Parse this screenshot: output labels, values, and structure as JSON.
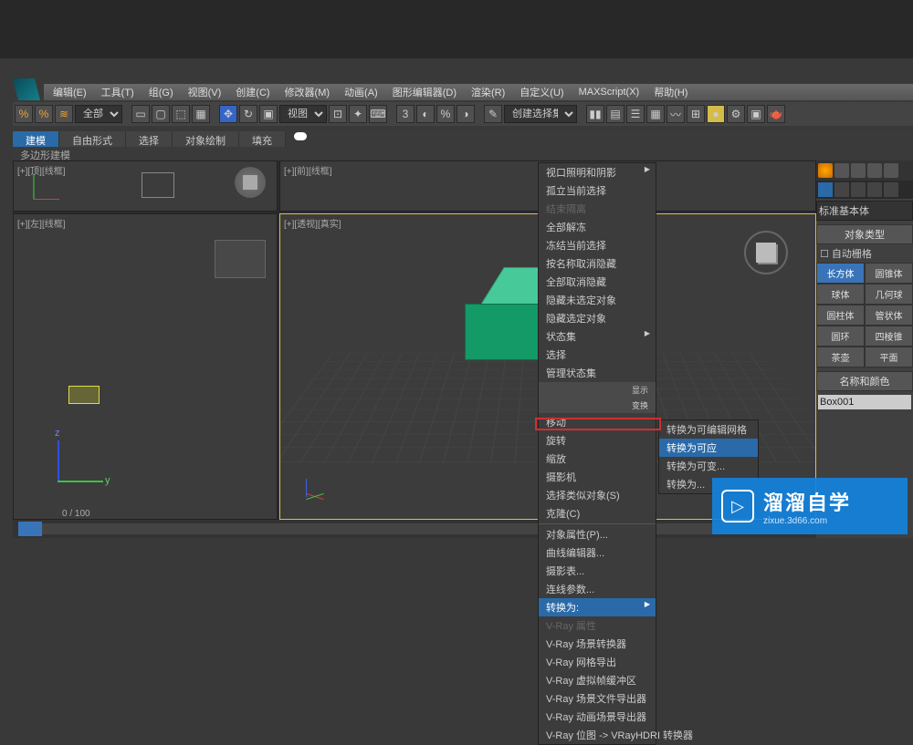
{
  "menubar": [
    "编辑(E)",
    "工具(T)",
    "组(G)",
    "视图(V)",
    "创建(C)",
    "修改器(M)",
    "动画(A)",
    "图形编辑器(D)",
    "渲染(R)",
    "自定义(U)",
    "MAXScript(X)",
    "帮助(H)"
  ],
  "toolbar": {
    "selector_all": "全部",
    "view_mode": "视图",
    "create_set": "创建选择集"
  },
  "ribbon": {
    "tabs": [
      "建模",
      "自由形式",
      "选择",
      "对象绘制",
      "填充"
    ],
    "sub": "多边形建模"
  },
  "viewports": {
    "vp1": "[+][顶][线框]",
    "vp2": "[+][前][线框]",
    "vp3": "[+][左][线框]",
    "vp4": "[+][透视][真实]"
  },
  "context_menu": {
    "items": [
      {
        "label": "视口照明和阴影",
        "arrow": true
      },
      {
        "label": "孤立当前选择"
      },
      {
        "label": "结束隔离",
        "disabled": true
      },
      {
        "label": "全部解冻"
      },
      {
        "label": "冻结当前选择"
      },
      {
        "label": "按名称取消隐藏"
      },
      {
        "label": "全部取消隐藏"
      },
      {
        "label": "隐藏未选定对象"
      },
      {
        "label": "隐藏选定对象"
      },
      {
        "label": "状态集",
        "arrow": true
      },
      {
        "label": "选择"
      },
      {
        "label": "管理状态集"
      },
      {
        "side": "显示"
      },
      {
        "side": "变换"
      },
      {
        "label": "移动"
      },
      {
        "label": "旋转"
      },
      {
        "label": "缩放"
      },
      {
        "label": "摄影机"
      },
      {
        "label": "选择类似对象(S)"
      },
      {
        "label": "克隆(C)"
      },
      {
        "label": "对象属性(P)..."
      },
      {
        "label": "曲线编辑器..."
      },
      {
        "label": "摄影表..."
      },
      {
        "label": "连线参数..."
      },
      {
        "label": "转换为:",
        "arrow": true,
        "highlight": true
      },
      {
        "label": "V-Ray 属性",
        "disabled": true
      },
      {
        "label": "V-Ray 场景转换器"
      },
      {
        "label": "V-Ray 网格导出"
      },
      {
        "label": "V-Ray 虚拟帧缓冲区"
      },
      {
        "label": "V-Ray 场景文件导出器"
      },
      {
        "label": "V-Ray 动画场景导出器"
      },
      {
        "label": "V-Ray 位图 -> VRayHDRI 转换器"
      }
    ]
  },
  "submenu": {
    "items": [
      "转换为可编辑网格",
      "转换为可应",
      "转换为可变...",
      "转换为..."
    ]
  },
  "panel": {
    "dropdown": "标准基本体",
    "section_type": "对象类型",
    "autogrid": "自动栅格",
    "buttons": [
      [
        "长方体",
        "圆锥体"
      ],
      [
        "球体",
        "几何球"
      ],
      [
        "圆柱体",
        "管状体"
      ],
      [
        "圆环",
        "四棱锥"
      ],
      [
        "茶壶",
        "平面"
      ]
    ],
    "section_name": "名称和颜色",
    "object_name": "Box001"
  },
  "timeline": {
    "frame": "0 / 100"
  },
  "watermark": {
    "title": "溜溜自学",
    "url": "zixue.3d66.com"
  }
}
